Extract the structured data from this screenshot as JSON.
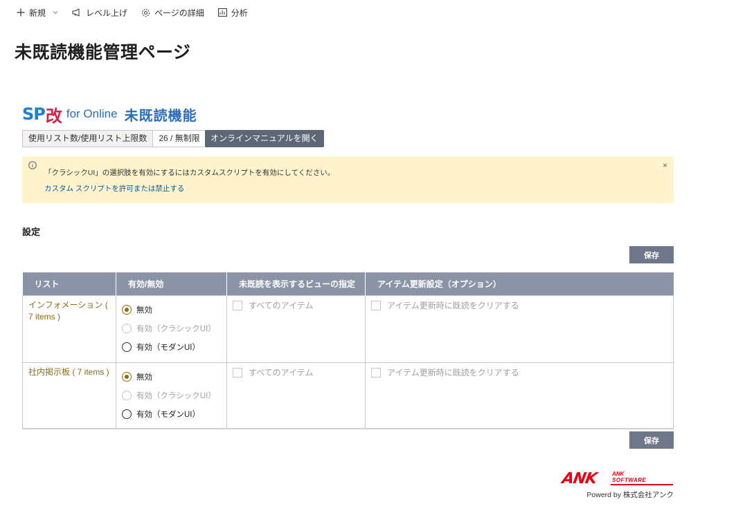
{
  "command_bar": {
    "new_label": "新規",
    "level_up_label": "レベル上げ",
    "page_details_label": "ページの詳細",
    "analytics_label": "分析"
  },
  "page_title": "未既読機能管理ページ",
  "logo": {
    "brand": "SP",
    "brand_kanji": "改",
    "for_online": "for Online",
    "feature": "未既読機能"
  },
  "usage": {
    "label": "使用リスト数/使用リスト上限数",
    "value": "26 / 無制限"
  },
  "manual_button": "オンラインマニュアルを開く",
  "notice": {
    "message": "「クラシックUI」の選択肢を有効にするにはカスタムスクリプトを有効にしてください。",
    "link": "カスタム スクリプトを許可または禁止する",
    "close": "×"
  },
  "settings": {
    "title": "設定",
    "save_label": "保存",
    "headers": [
      "リスト",
      "有効/無効",
      "未既読を表示するビューの指定",
      "アイテム更新設定（オプション）"
    ],
    "radio_labels": {
      "disabled": "無効",
      "classic": "有効（クラシックUI）",
      "modern": "有効（モダンUI）"
    },
    "rows": [
      {
        "list": "インフォメーション ( 7 items )",
        "selected": "disabled",
        "view_label": "すべてのアイテム",
        "update_label": "アイテム更新時に既読をクリアする"
      },
      {
        "list": "社内掲示板 ( 7 items )",
        "selected": "disabled",
        "view_label": "すべてのアイテム",
        "update_label": "アイテム更新時に既読をクリアする"
      }
    ]
  },
  "footer": {
    "ank_mark": "ANK",
    "ank_word1": "ANK",
    "ank_word2": "SOFTWARE",
    "powered_by": "Powerd by 株式会社アンク"
  },
  "colors": {
    "accent_radio": "#8a6d13",
    "header_bg": "#8b94a7",
    "save_bg": "#6e7689",
    "notice_bg": "#fff4ce",
    "link": "#005a9e"
  }
}
